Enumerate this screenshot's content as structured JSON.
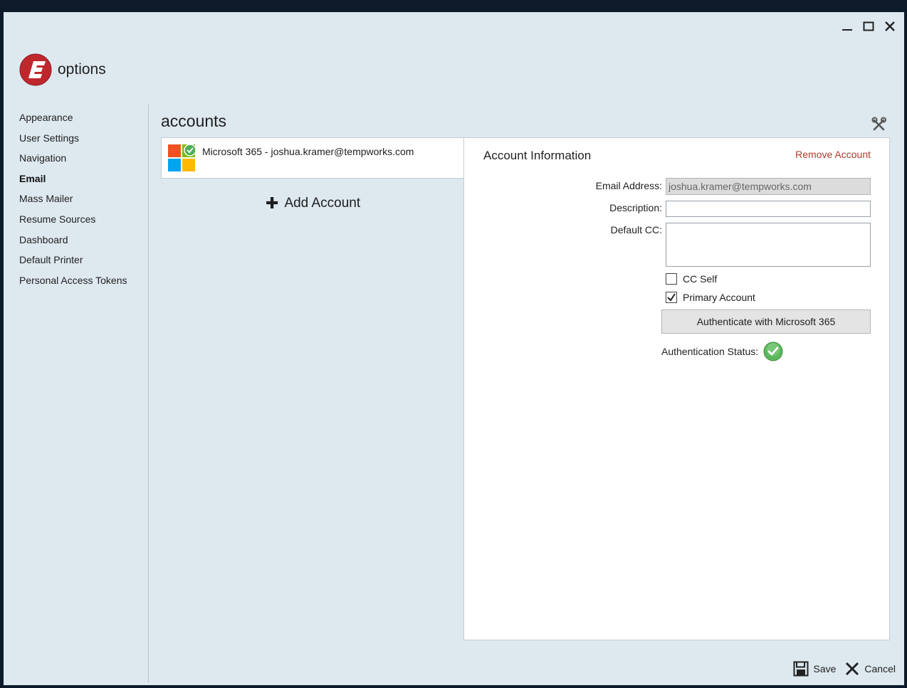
{
  "window": {
    "controls": {
      "minimize": "minimize-icon",
      "maximize": "maximize-icon",
      "close": "close-icon"
    }
  },
  "header": {
    "title": "options",
    "logo_letter": "E",
    "logo_color": "#c0272d"
  },
  "sidebar": {
    "items": [
      {
        "label": "Appearance",
        "active": false
      },
      {
        "label": "User Settings",
        "active": false
      },
      {
        "label": "Navigation",
        "active": false
      },
      {
        "label": "Email",
        "active": true
      },
      {
        "label": "Mass Mailer",
        "active": false
      },
      {
        "label": "Resume Sources",
        "active": false
      },
      {
        "label": "Dashboard",
        "active": false
      },
      {
        "label": "Default Printer",
        "active": false
      },
      {
        "label": "Personal Access Tokens",
        "active": false
      }
    ]
  },
  "main": {
    "title": "accounts",
    "accounts": [
      {
        "label": "Microsoft 365 - joshua.kramer@tempworks.com",
        "icon": "microsoft-logo-icon",
        "verified": true
      }
    ],
    "add_account_label": "Add Account"
  },
  "account_info": {
    "title": "Account Information",
    "remove_label": "Remove Account",
    "email_label": "Email Address:",
    "email_value": "joshua.kramer@tempworks.com",
    "description_label": "Description:",
    "description_value": "",
    "default_cc_label": "Default CC:",
    "default_cc_value": "",
    "cc_self_label": "CC Self",
    "cc_self_checked": false,
    "primary_label": "Primary Account",
    "primary_checked": true,
    "auth_button_label": "Authenticate with Microsoft 365",
    "auth_status_label": "Authentication Status:",
    "auth_status_ok": true
  },
  "footer": {
    "save_label": "Save",
    "cancel_label": "Cancel"
  },
  "colors": {
    "window_bg": "#dde8ef",
    "accent_red": "#b13a2e",
    "ok_green": "#4caf50"
  }
}
